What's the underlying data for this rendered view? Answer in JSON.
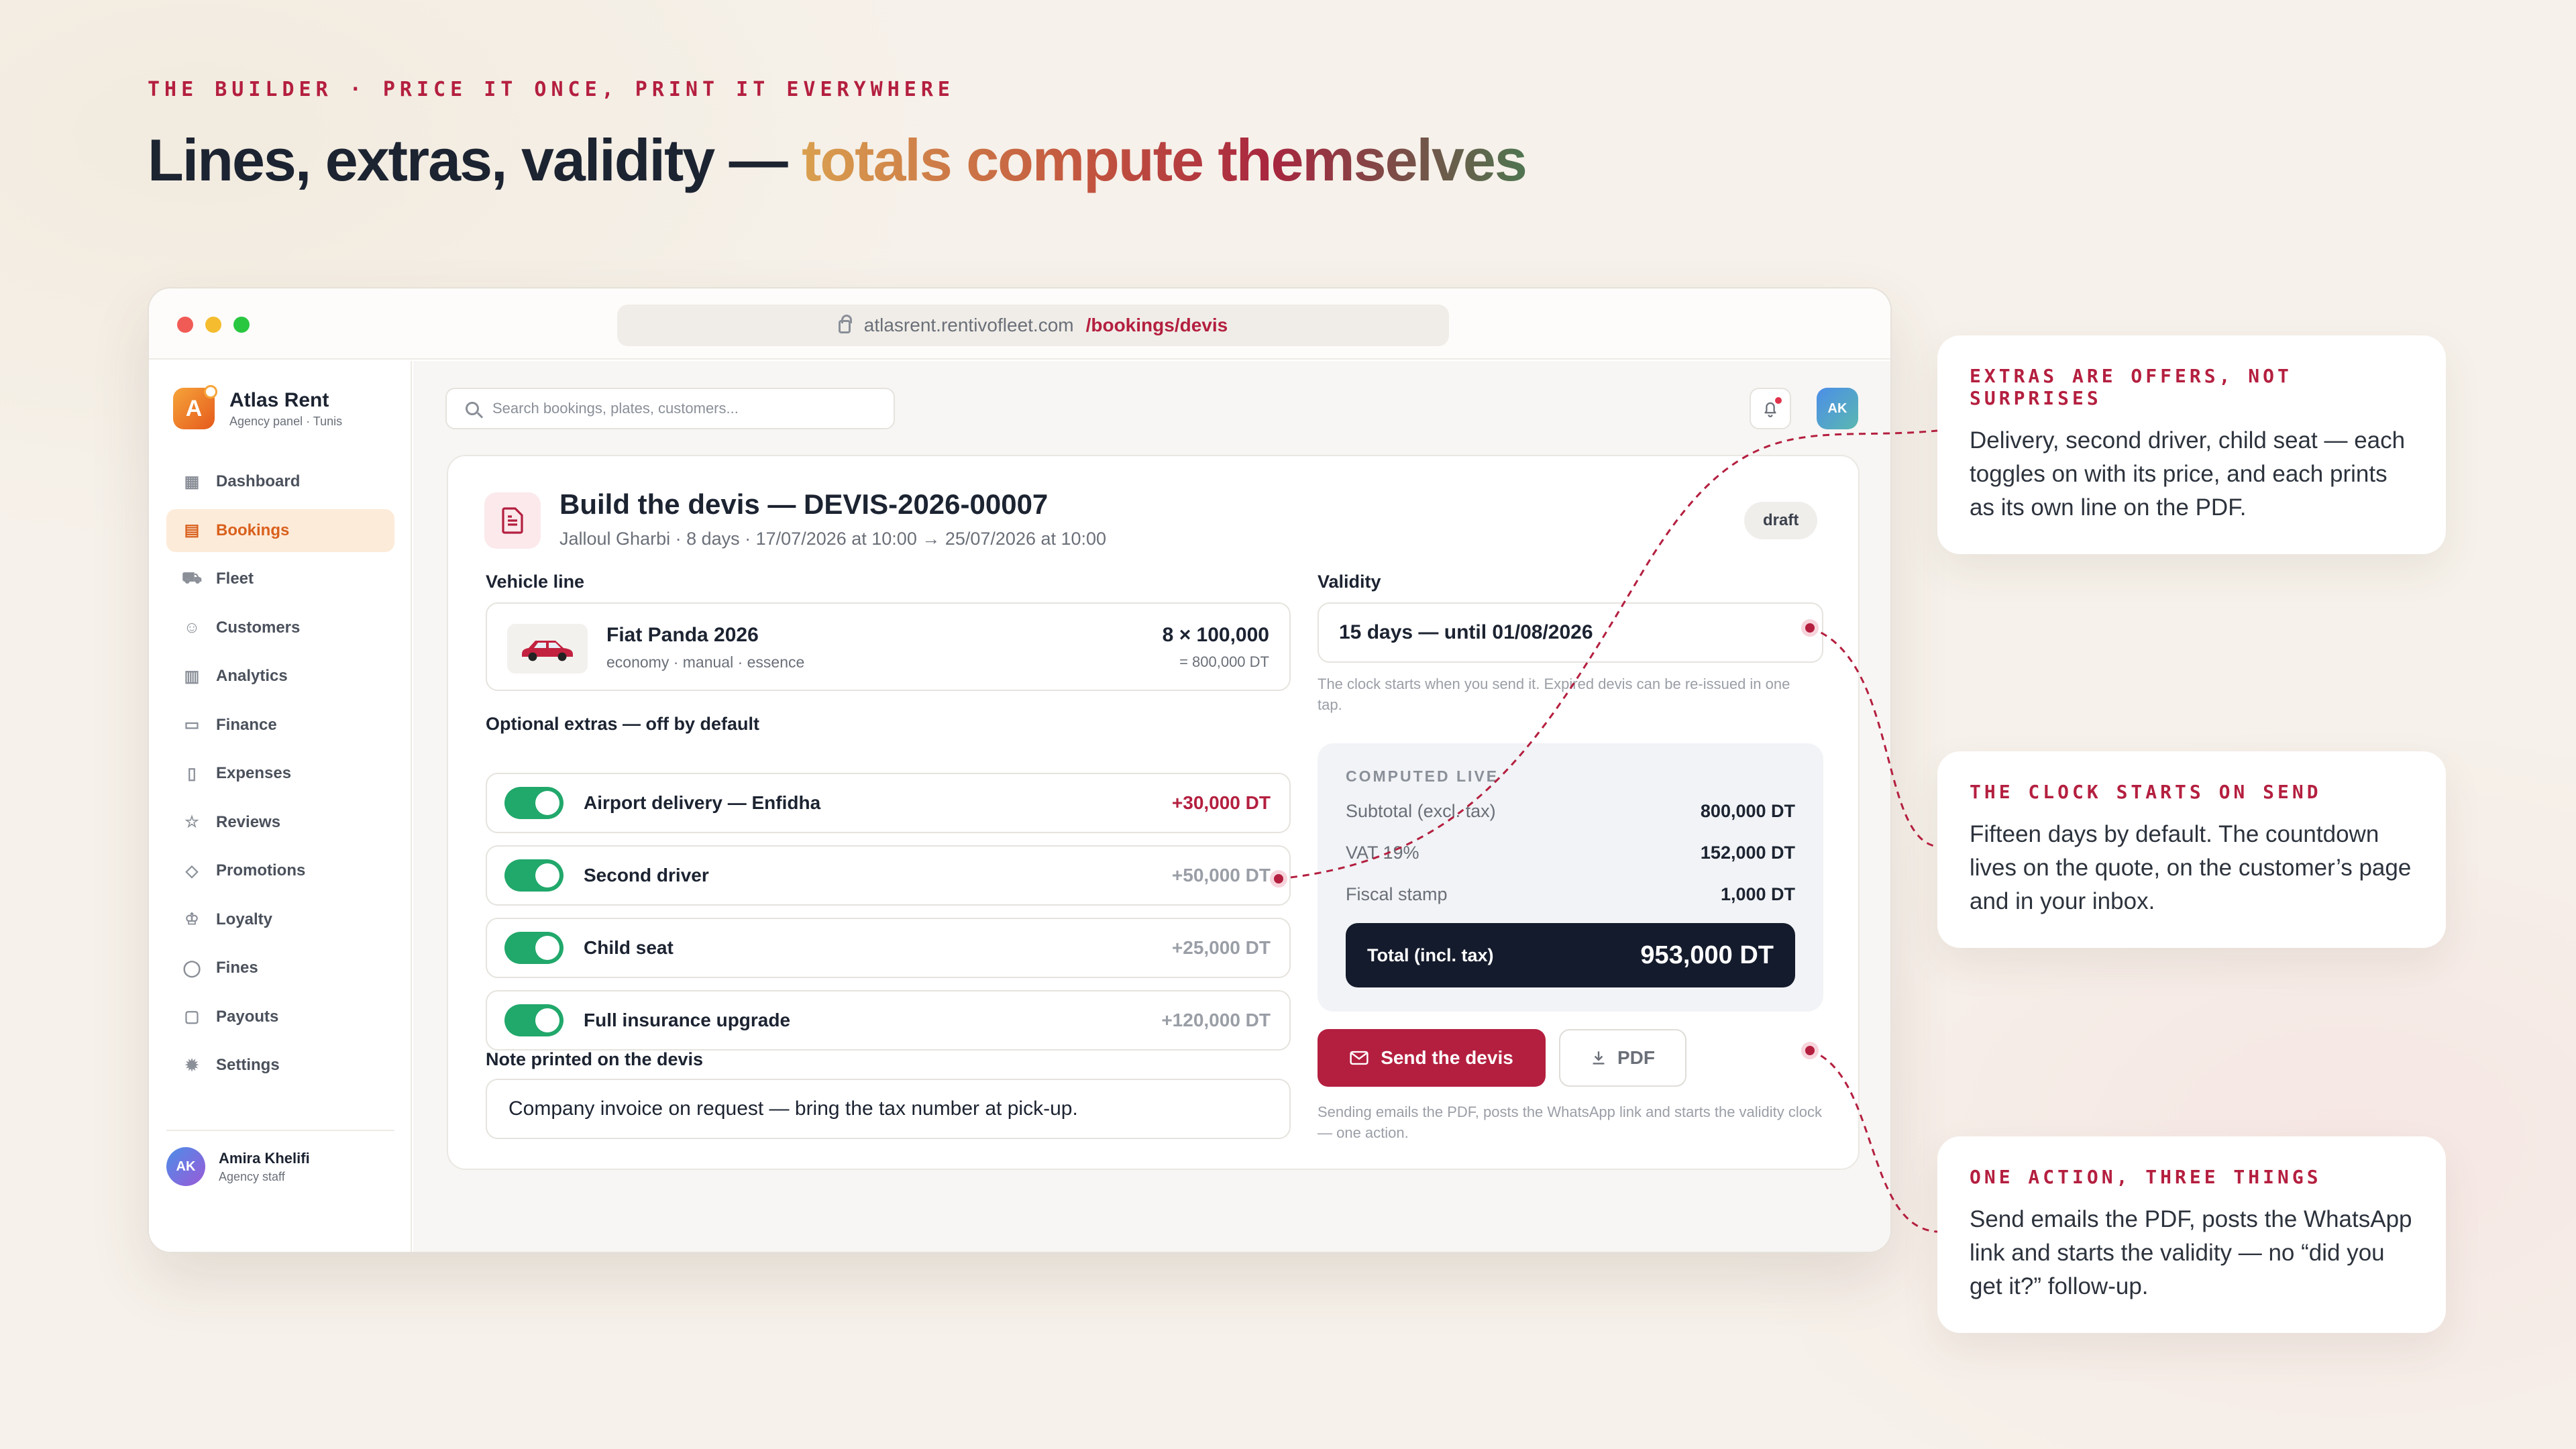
{
  "hero": {
    "eyebrow": "THE BUILDER · PRICE IT ONCE, PRINT IT EVERYWHERE",
    "title_plain": "Lines, extras, validity — ",
    "title_accent": "totals compute themselves"
  },
  "browser": {
    "url_host": "atlasrent.rentivofleet.com",
    "url_path": "/bookings/devis"
  },
  "brand": {
    "name": "Atlas Rent",
    "sub": "Agency panel · Tunis",
    "logo": "A"
  },
  "nav": [
    {
      "label": "Dashboard",
      "icon": "grid-icon",
      "glyph": "▦"
    },
    {
      "label": "Bookings",
      "icon": "calendar-icon",
      "glyph": "▤",
      "active": true
    },
    {
      "label": "Fleet",
      "icon": "car-icon",
      "glyph": "⛟"
    },
    {
      "label": "Customers",
      "icon": "users-icon",
      "glyph": "☺"
    },
    {
      "label": "Analytics",
      "icon": "bar-chart-icon",
      "glyph": "▥"
    },
    {
      "label": "Finance",
      "icon": "banknote-icon",
      "glyph": "▭"
    },
    {
      "label": "Expenses",
      "icon": "receipt-icon",
      "glyph": "▯"
    },
    {
      "label": "Reviews",
      "icon": "star-icon",
      "glyph": "☆"
    },
    {
      "label": "Promotions",
      "icon": "tag-icon",
      "glyph": "◇"
    },
    {
      "label": "Loyalty",
      "icon": "crown-icon",
      "glyph": "♔"
    },
    {
      "label": "Fines",
      "icon": "shield-icon",
      "glyph": "◯"
    },
    {
      "label": "Payouts",
      "icon": "wallet-icon",
      "glyph": "▢"
    },
    {
      "label": "Settings",
      "icon": "gear-icon",
      "glyph": "✹"
    }
  ],
  "user": {
    "initials": "AK",
    "name": "Amira Khelifi",
    "role": "Agency staff"
  },
  "topbar": {
    "search_placeholder": "Search bookings, plates, customers...",
    "avatar": "AK"
  },
  "devis": {
    "title": "Build the devis — DEVIS-2026-00007",
    "subtitle": "Jalloul Gharbi · 8 days · 17/07/2026 at 10:00 → 25/07/2026 at 10:00",
    "status": "draft",
    "vehicle_label": "Vehicle line",
    "vehicle": {
      "name": "Fiat Panda 2026",
      "meta": "economy · manual · essence",
      "price": "8 × 100,000",
      "total": "= 800,000 DT"
    },
    "extras_label": "Optional extras — off by default",
    "extras": [
      {
        "name": "Airport delivery — Enfidha",
        "price": "+30,000 DT",
        "on": true,
        "highlight": true
      },
      {
        "name": "Second driver",
        "price": "+50,000 DT",
        "on": true,
        "highlight": false
      },
      {
        "name": "Child seat",
        "price": "+25,000 DT",
        "on": true,
        "highlight": false
      },
      {
        "name": "Full insurance upgrade",
        "price": "+120,000 DT",
        "on": true,
        "highlight": false
      }
    ],
    "note_label": "Note printed on the devis",
    "note": "Company invoice on request — bring the tax number at pick-up.",
    "validity_label": "Validity",
    "validity": "15 days — until 01/08/2026",
    "validity_hint": "The clock starts when you send it. Expired devis can be re-issued in one tap.",
    "computed": {
      "label": "COMPUTED LIVE",
      "rows": [
        {
          "k": "Subtotal (excl. tax)",
          "v": "800,000 DT"
        },
        {
          "k": "VAT 19%",
          "v": "152,000 DT"
        },
        {
          "k": "Fiscal stamp",
          "v": "1,000 DT"
        }
      ],
      "total_label": "Total (incl. tax)",
      "total_value": "953,000 DT"
    },
    "send_label": "Send the devis",
    "pdf_label": "PDF",
    "send_hint": "Sending emails the PDF, posts the WhatsApp link and starts the validity clock — one action."
  },
  "callouts": [
    {
      "title": "EXTRAS ARE OFFERS, NOT SURPRISES",
      "body": "Delivery, second driver, child seat — each toggles on with its price, and each prints as its own line on the PDF."
    },
    {
      "title": "THE CLOCK STARTS ON SEND",
      "body": "Fifteen days by default. The countdown lives on the quote, on the customer’s page and in your inbox."
    },
    {
      "title": "ONE ACTION, THREE THINGS",
      "body": "Send emails the PDF, posts the WhatsApp link and starts the validity — no “did you get it?” follow-up."
    }
  ],
  "colors": {
    "accent": "#b41f3f",
    "brand_orange": "#e55a1c",
    "toggle_on": "#21a86b",
    "total_bg": "#141b2c"
  }
}
